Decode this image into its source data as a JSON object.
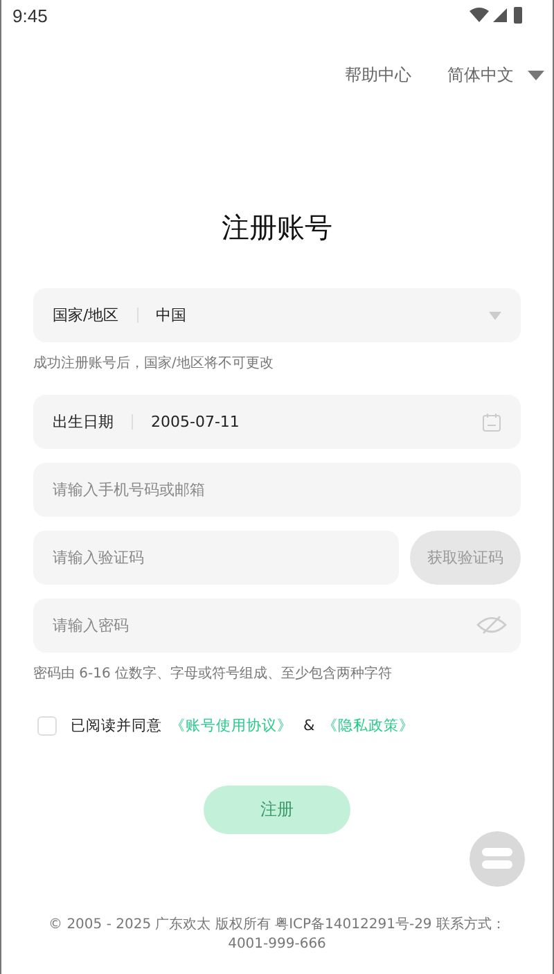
{
  "status_bar": {
    "time": "9:45"
  },
  "top_links": {
    "help": "帮助中心",
    "language": "简体中文"
  },
  "title": "注册账号",
  "region": {
    "label": "国家/地区",
    "value": "中国"
  },
  "region_note": "成功注册账号后，国家/地区将不可更改",
  "birthday": {
    "label": "出生日期",
    "value": "2005-07-11"
  },
  "account": {
    "placeholder": "请输入手机号码或邮箱"
  },
  "code": {
    "placeholder": "请输入验证码",
    "button": "获取验证码",
    "disabled": true
  },
  "password": {
    "placeholder": "请输入密码"
  },
  "password_note": "密码由 6-16 位数字、字母或符号组成、至少包含两种字符",
  "agreement": {
    "checked": false,
    "text": "已阅读并同意",
    "link1": "《账号使用协议》",
    "and": "&",
    "link2": "《隐私政策》"
  },
  "register": {
    "label": "注册",
    "disabled": true
  },
  "footer": "© 2005 - 2025 广东欢太 版权所有 粤ICP备14012291号-29 联系方式：4001-999-666"
}
